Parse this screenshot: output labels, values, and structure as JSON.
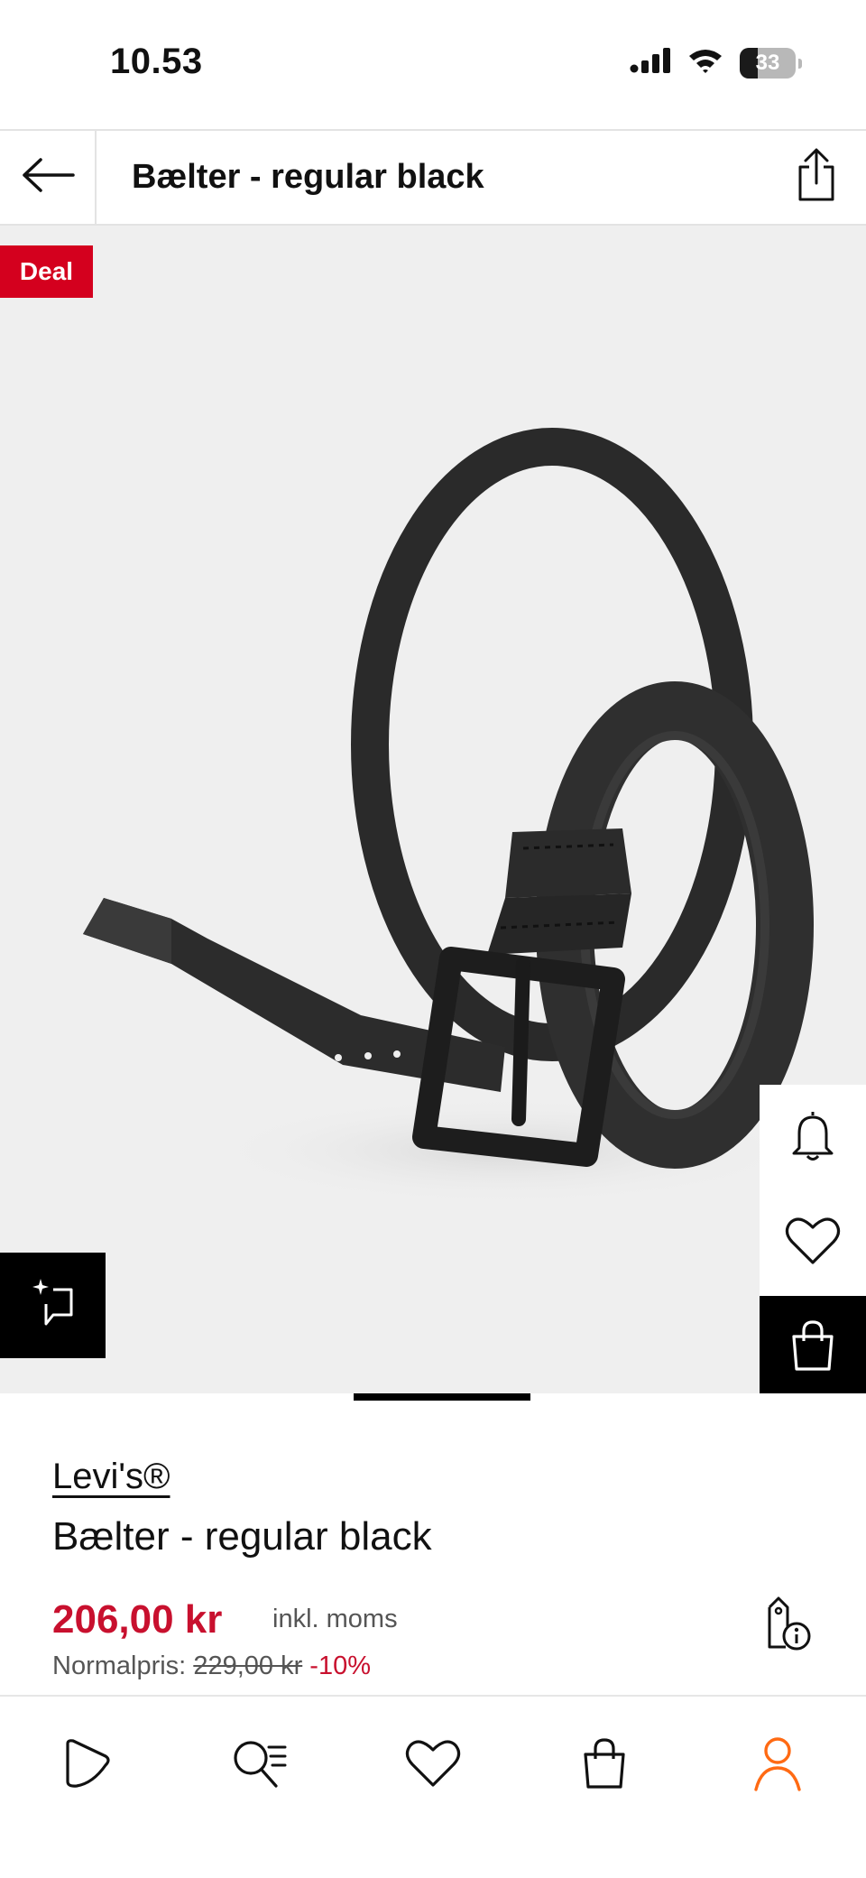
{
  "status_bar": {
    "time": "10.53",
    "battery_level": "33",
    "icons": [
      "signal-icon",
      "wifi-icon",
      "battery-icon"
    ]
  },
  "header": {
    "title": "Bælter - regular black",
    "back_icon": "arrow-left-icon",
    "share_icon": "share-icon"
  },
  "gallery": {
    "deal_label": "Deal",
    "image": "black-leather-belt-image",
    "image_progress": 0.2,
    "side_actions": [
      "bell-icon",
      "heart-icon",
      "shopping-bag-icon"
    ],
    "ai_icon": "sparkle-chat-icon"
  },
  "product": {
    "brand": "Levi's®",
    "name": "Bælter - regular black",
    "price": "206,00 kr",
    "price_note": "inkl. moms",
    "normal_label": "Normalpris:",
    "normal_price": "229,00 kr",
    "discount": "-10%"
  },
  "bottom_nav": {
    "items": [
      "home-icon",
      "search-icon",
      "wishlist-icon",
      "bag-icon",
      "account-icon"
    ],
    "active": "account-icon"
  },
  "colors": {
    "accent_red": "#c8102e",
    "deal_red": "#d4001e",
    "active_nav": "#ff6a13"
  }
}
